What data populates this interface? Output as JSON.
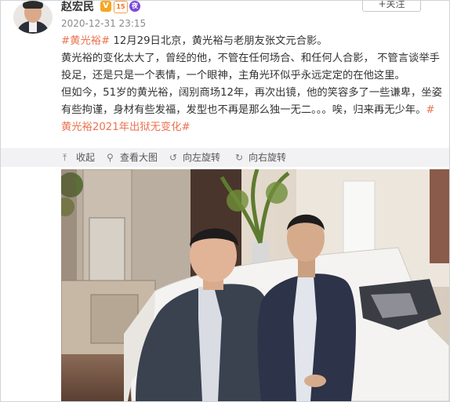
{
  "user": {
    "name": "赵宏民",
    "badges": [
      "V",
      "15",
      "夜"
    ],
    "time": "2020-12-31 23:15"
  },
  "follow_label": "+关注",
  "post": {
    "line1": {
      "tag1": "#黄光裕#",
      "text": " 12月29日北京，黄光裕与老朋友张文元合影。"
    },
    "para2": "黄光裕的变化太大了，曾经的他，不管在任何场合、和任何人合影， 不管言谈举手投足，还是只是一个表情，一个眼神，主角光环似乎永远定定的在他这里。",
    "para3": "但如今，51岁的黄光裕，阔别商场12年，再次出镜，他的笑容多了一些谦卑，坐姿有些拘谨，身材有些发福，发型也不再是那么独一无二。。。唉，归来再无少年。",
    "tag2": "#黄光裕2021年出狱无变化#"
  },
  "toolbar": {
    "collapse": "收起",
    "view_large": "查看大图",
    "rotate_left": "向左旋转",
    "rotate_right": "向右旋转"
  },
  "icons": {
    "collapse": "collapse-icon",
    "view_large": "search-icon",
    "rotate_left": "rotate-left-icon",
    "rotate_right": "rotate-right-icon"
  }
}
